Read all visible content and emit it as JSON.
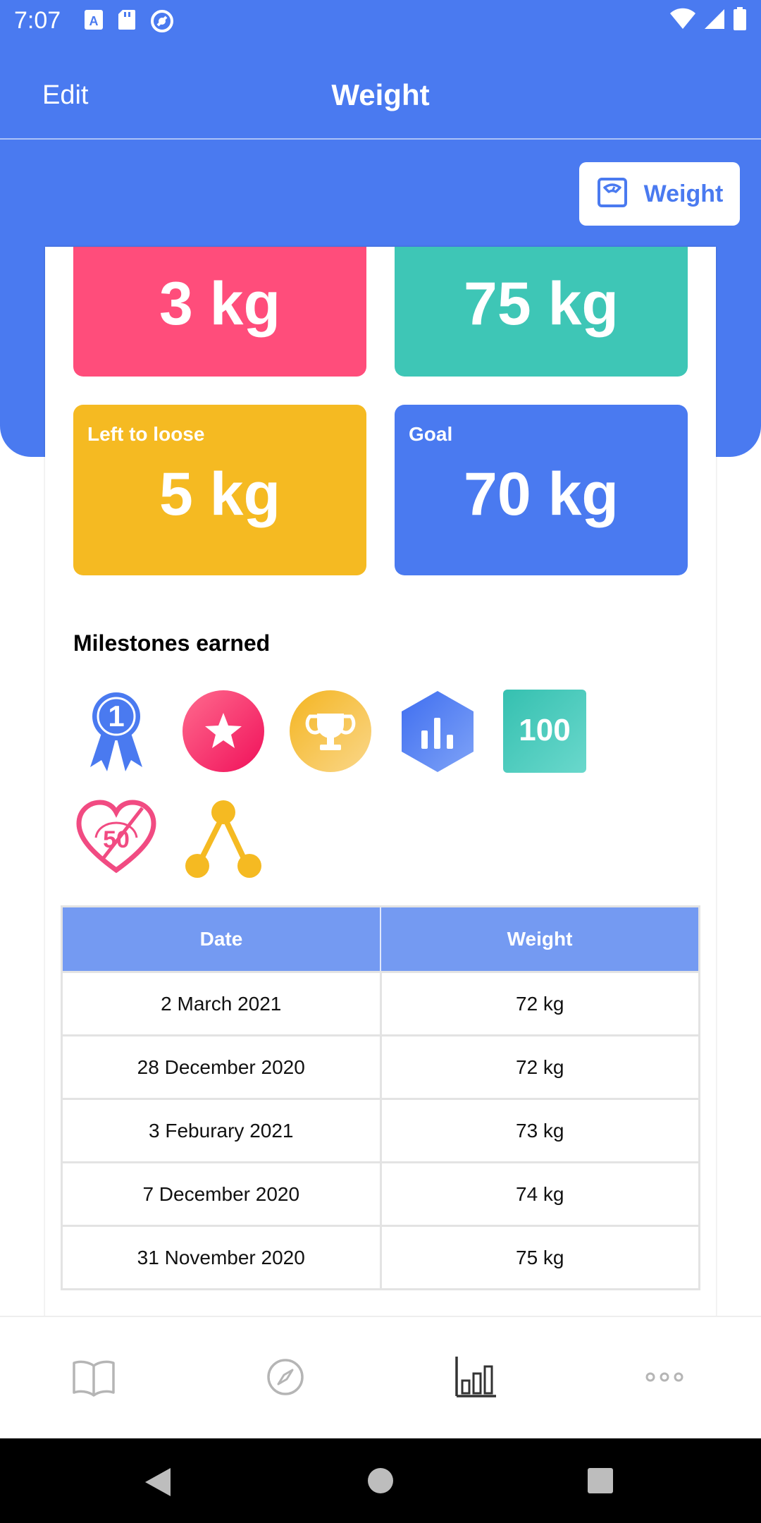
{
  "status_bar": {
    "time": "7:07",
    "icons_left": [
      "text-a-icon",
      "sd-card-icon",
      "sync-icon"
    ],
    "icons_right": [
      "wifi-icon",
      "signal-icon",
      "battery-icon"
    ]
  },
  "header": {
    "edit_label": "Edit",
    "title": "Weight",
    "weight_button_label": "Weight",
    "weight_button_icon": "scale-icon"
  },
  "stats": {
    "pink": {
      "label": "",
      "value": "3 kg",
      "color": "#ff4d7b"
    },
    "teal": {
      "label": "",
      "value": "75 kg",
      "color": "#3ec6b6"
    },
    "yellow": {
      "label": "Left to loose",
      "value": "5 kg",
      "color": "#f5ba22"
    },
    "blue": {
      "label": "Goal",
      "value": "70 kg",
      "color": "#4a7af0"
    }
  },
  "milestones": {
    "title": "Milestones earned",
    "badges": [
      {
        "icon": "ribbon-1-icon",
        "text": "1"
      },
      {
        "icon": "star-badge-icon",
        "text": ""
      },
      {
        "icon": "trophy-badge-icon",
        "text": ""
      },
      {
        "icon": "chart-hexagon-icon",
        "text": ""
      },
      {
        "icon": "hundred-badge-icon",
        "text": "100"
      },
      {
        "icon": "heart-50-icon",
        "text": "50"
      },
      {
        "icon": "share-nodes-icon",
        "text": ""
      }
    ]
  },
  "table": {
    "headers": [
      "Date",
      "Weight"
    ],
    "rows": [
      [
        "2 March 2021",
        "72 kg"
      ],
      [
        "28 December 2020",
        "72 kg"
      ],
      [
        "3 Feburary 2021",
        "73 kg"
      ],
      [
        "7 December 2020",
        "74 kg"
      ],
      [
        "31 November 2020",
        "75 kg"
      ]
    ]
  },
  "bottom_nav": {
    "items": [
      "book-icon",
      "compass-icon",
      "bar-chart-icon",
      "more-icon"
    ],
    "active_index": 2
  },
  "colors": {
    "primary": "#4a7af0",
    "table_header": "#749af2",
    "yellow": "#f5ba22",
    "pink": "#ff4d7b",
    "teal": "#3ec6b6"
  }
}
